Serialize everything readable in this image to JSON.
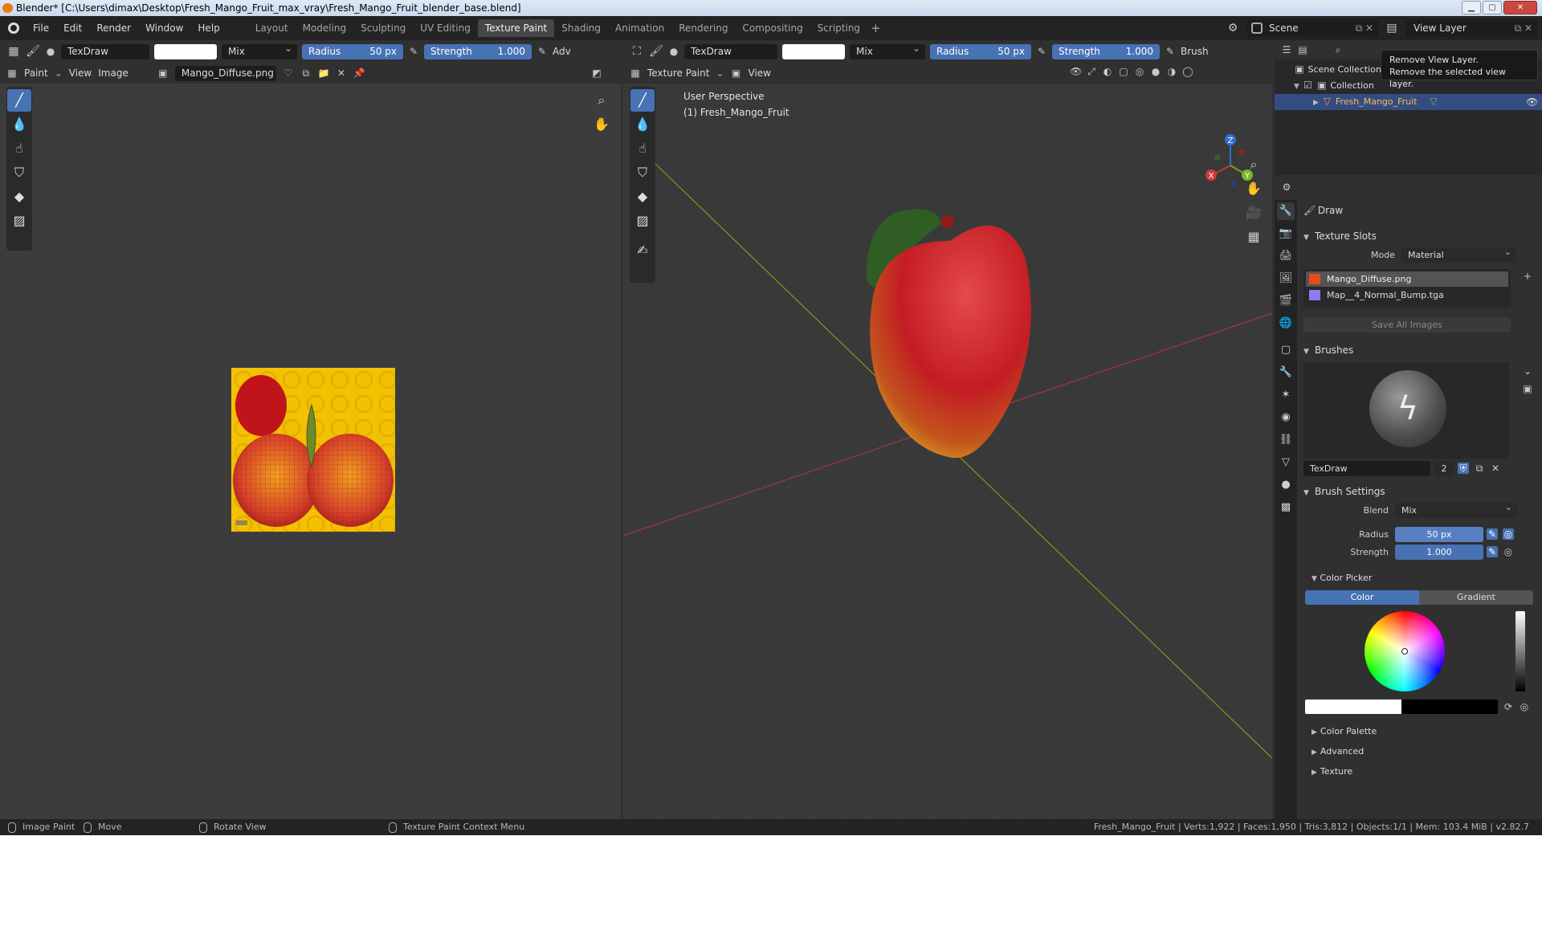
{
  "window": {
    "title": "Blender* [C:\\Users\\dimax\\Desktop\\Fresh_Mango_Fruit_max_vray\\Fresh_Mango_Fruit_blender_base.blend]"
  },
  "menu": [
    "File",
    "Edit",
    "Render",
    "Window",
    "Help"
  ],
  "workspaces": [
    "Layout",
    "Modeling",
    "Sculpting",
    "UV Editing",
    "Texture Paint",
    "Shading",
    "Animation",
    "Rendering",
    "Compositing",
    "Scripting"
  ],
  "active_workspace": "Texture Paint",
  "scene": {
    "name": "Scene",
    "view_layer": "View Layer"
  },
  "tooltip": {
    "line1": "Remove View Layer.",
    "line2": "Remove the selected view layer."
  },
  "image_editor": {
    "brush_name": "TexDraw",
    "blend": "Mix",
    "radius_label": "Radius",
    "radius_value": "50 px",
    "strength_label": "Strength",
    "strength_value": "1.000",
    "adv": "Adv",
    "mode": "Paint",
    "view_menu": "View",
    "image_menu": "Image",
    "image_name": "Mango_Diffuse.png"
  },
  "viewport": {
    "brush_name": "TexDraw",
    "blend": "Mix",
    "radius_label": "Radius",
    "radius_value": "50 px",
    "strength_label": "Strength",
    "strength_value": "1.000",
    "brush_menu": "Brush",
    "mode": "Texture Paint",
    "view_menu": "View",
    "overlay_line1": "User Perspective",
    "overlay_line2": "(1) Fresh_Mango_Fruit",
    "axes": {
      "x": "X",
      "y": "Y",
      "z": "Z"
    }
  },
  "outliner": {
    "scene_collection": "Scene Collection",
    "collection": "Collection",
    "object": "Fresh_Mango_Fruit"
  },
  "properties": {
    "tool_name": "Draw",
    "texture_slots": {
      "title": "Texture Slots",
      "mode_label": "Mode",
      "mode_value": "Material",
      "slots": [
        "Mango_Diffuse.png",
        "Map__4_Normal_Bump.tga"
      ],
      "save_all": "Save All Images"
    },
    "brushes": {
      "title": "Brushes",
      "brush_name": "TexDraw",
      "users": "2"
    },
    "brush_settings": {
      "title": "Brush Settings",
      "blend_label": "Blend",
      "blend_value": "Mix",
      "radius_label": "Radius",
      "radius_value": "50 px",
      "strength_label": "Strength",
      "strength_value": "1.000",
      "color_picker": "Color Picker",
      "color_tab": "Color",
      "gradient_tab": "Gradient",
      "color_palette": "Color Palette",
      "advanced": "Advanced",
      "texture": "Texture"
    }
  },
  "status": {
    "left1": "Image Paint",
    "left2": "Move",
    "left3": "Rotate View",
    "left4": "Texture Paint Context Menu",
    "stats": "Fresh_Mango_Fruit | Verts:1,922 | Faces:1,950 | Tris:3,812 | Objects:1/1 | Mem: 103.4 MiB | v2.82.7"
  },
  "colors": {
    "accent": "#4772b3",
    "header": "#303030",
    "editor_bg": "#3c3c3c",
    "texture_yellow": "#f2c200",
    "mango_red": "#c8212a"
  }
}
